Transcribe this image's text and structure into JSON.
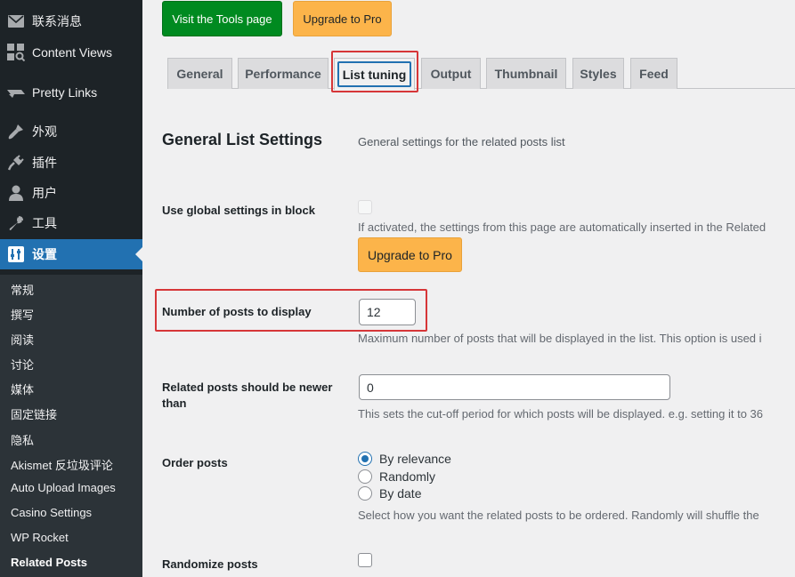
{
  "sidebar": {
    "items": [
      {
        "label": "联系消息",
        "icon": "mail-icon"
      },
      {
        "label": "Content Views",
        "icon": "grid-icon"
      },
      {
        "label": "Pretty Links",
        "icon": "link-icon"
      },
      {
        "label": "外观",
        "icon": "brush-icon"
      },
      {
        "label": "插件",
        "icon": "plugin-icon"
      },
      {
        "label": "用户",
        "icon": "user-icon"
      },
      {
        "label": "工具",
        "icon": "wrench-icon"
      },
      {
        "label": "设置",
        "icon": "settings-icon"
      }
    ],
    "active_index": 7,
    "submenu": [
      "常规",
      "撰写",
      "阅读",
      "讨论",
      "媒体",
      "固定链接",
      "隐私",
      "Akismet 反垃圾评论",
      "Auto Upload Images",
      "Casino Settings",
      "WP Rocket",
      "Related Posts"
    ],
    "submenu_current_index": 11
  },
  "toolbar": {
    "tools_button": "Visit the Tools page",
    "upgrade_button": "Upgrade to Pro"
  },
  "tabs": [
    "General",
    "Performance",
    "List tuning",
    "Output",
    "Thumbnail",
    "Styles",
    "Feed"
  ],
  "active_tab": "List tuning",
  "section": {
    "title": "General List Settings",
    "description": "General settings for the related posts list"
  },
  "settings": {
    "use_global": {
      "label": "Use global settings in block",
      "checked": false,
      "description": "If activated, the settings from this page are automatically inserted in the Related",
      "upgrade_button": "Upgrade to Pro"
    },
    "num_posts": {
      "label": "Number of posts to display",
      "value": "12",
      "description": "Maximum number of posts that will be displayed in the list. This option is used i"
    },
    "newer_than": {
      "label_line1": "Related posts should be newer",
      "label_line2": "than",
      "value": "0",
      "description": "This sets the cut-off period for which posts will be displayed. e.g. setting it to 36"
    },
    "order": {
      "label": "Order posts",
      "options": [
        "By relevance",
        "Randomly",
        "By date"
      ],
      "selected": "By relevance",
      "description": "Select how you want the related posts to be ordered. Randomly will shuffle the"
    },
    "randomize": {
      "label": "Randomize posts",
      "checked": false
    }
  },
  "colors": {
    "sidebar_bg": "#1d2327",
    "active_menu": "#2271b1",
    "highlight_red": "#d63638",
    "tools_button_green": "#008a20",
    "upgrade_orange": "#fcb44a"
  }
}
